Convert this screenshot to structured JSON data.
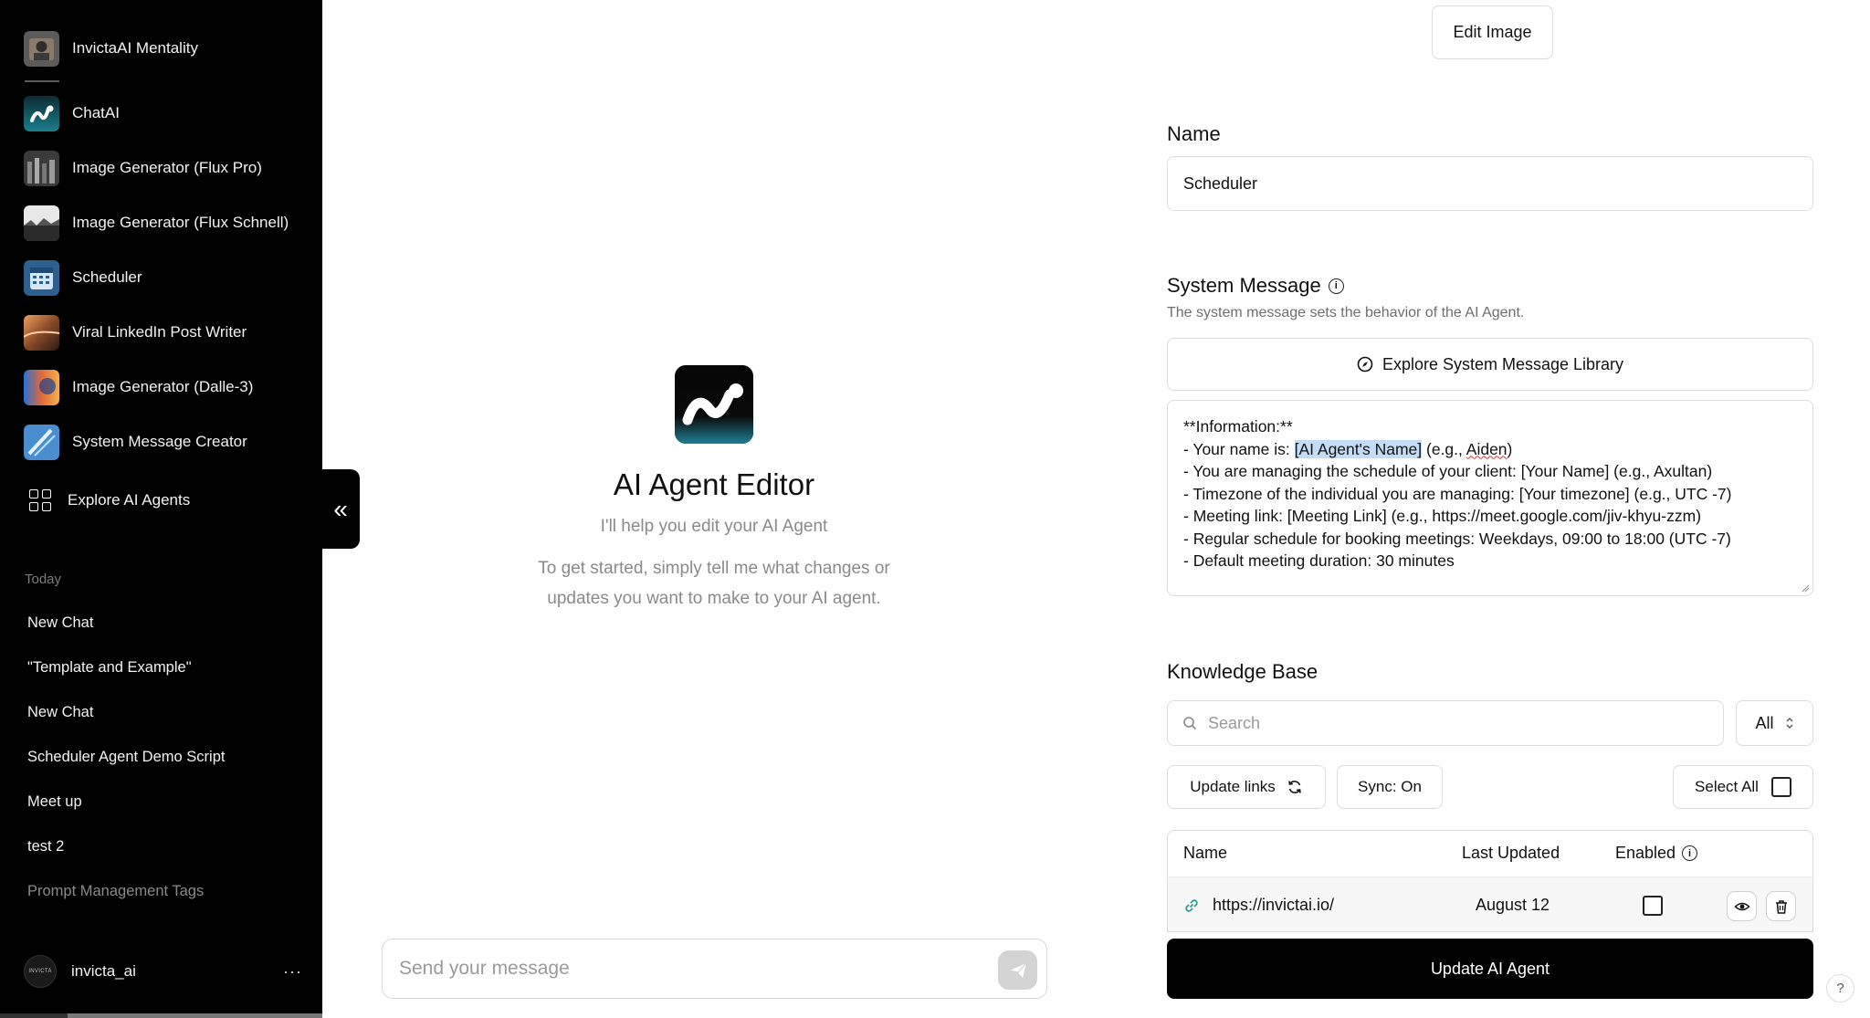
{
  "sidebar": {
    "agents": [
      {
        "label": "InvictaAI Mentality",
        "icon": "mentality-avatar-icon"
      },
      {
        "label": "ChatAI",
        "icon": "chatai-logo-icon"
      },
      {
        "label": "Image Generator (Flux Pro)",
        "icon": "flux-pro-thumbnail-icon"
      },
      {
        "label": "Image Generator (Flux Schnell)",
        "icon": "flux-schnell-thumbnail-icon"
      },
      {
        "label": "Scheduler",
        "icon": "scheduler-calendar-icon"
      },
      {
        "label": "Viral LinkedIn Post Writer",
        "icon": "linkedin-writer-thumbnail-icon"
      },
      {
        "label": "Image Generator (Dalle-3)",
        "icon": "dalle-thumbnail-icon"
      },
      {
        "label": "System Message Creator",
        "icon": "system-message-creator-icon"
      }
    ],
    "explore_label": "Explore AI Agents",
    "section_today": "Today",
    "chats": [
      "New Chat",
      "\"Template and Example\"",
      "New Chat",
      "Scheduler Agent Demo Script",
      "Meet up",
      "test 2",
      "Prompt Management Tags"
    ],
    "user": {
      "name": "invicta_ai",
      "avatar_text": "INVICTA",
      "more": "···"
    },
    "collapse_icon": "«"
  },
  "center": {
    "title": "AI Agent Editor",
    "subtitle": "I'll help you edit your AI Agent",
    "description": "To get started, simply tell me what changes or updates you want to make to your AI agent.",
    "input_placeholder": "Send your message"
  },
  "panel": {
    "edit_image_label": "Edit Image",
    "name_label": "Name",
    "name_value": "Scheduler",
    "system_label": "System Message",
    "system_help": "The system message sets the behavior of the AI Agent.",
    "explore_library_label": "Explore System Message Library",
    "system_message": {
      "line1": "**Information:**",
      "line2_pre": "- Your name is: ",
      "line2_hl": "[AI Agent's Name]",
      "line2_mid": " (e.g., ",
      "line2_sq": "Aiden",
      "line2_post": ")",
      "line3": "- You are managing the schedule of your client: [Your Name] (e.g., Axultan)",
      "line4": "- Timezone of the individual you are managing: [Your timezone] (e.g., UTC -7)",
      "line5": "- Meeting link: [Meeting Link] (e.g., https://meet.google.com/jiv-khyu-zzm)",
      "line6": "- Regular schedule for booking meetings: Weekdays, 09:00 to 18:00 (UTC -7)",
      "line7": "- Default meeting duration: 30 minutes"
    },
    "kb_label": "Knowledge Base",
    "kb_search_placeholder": "Search",
    "kb_filter": "All",
    "update_links_label": "Update links",
    "sync_label": "Sync: On",
    "select_all_label": "Select All",
    "table": {
      "col_name": "Name",
      "col_updated": "Last Updated",
      "col_enabled": "Enabled",
      "rows": [
        {
          "name": "https://invictai.io/",
          "updated": "August 12",
          "enabled": false
        }
      ]
    },
    "update_agent_label": "Update AI Agent",
    "help_label": "?"
  },
  "colors": {
    "sidebar_bg": "#000000",
    "accent_button": "#000000",
    "highlight": "#c5dcf7"
  }
}
